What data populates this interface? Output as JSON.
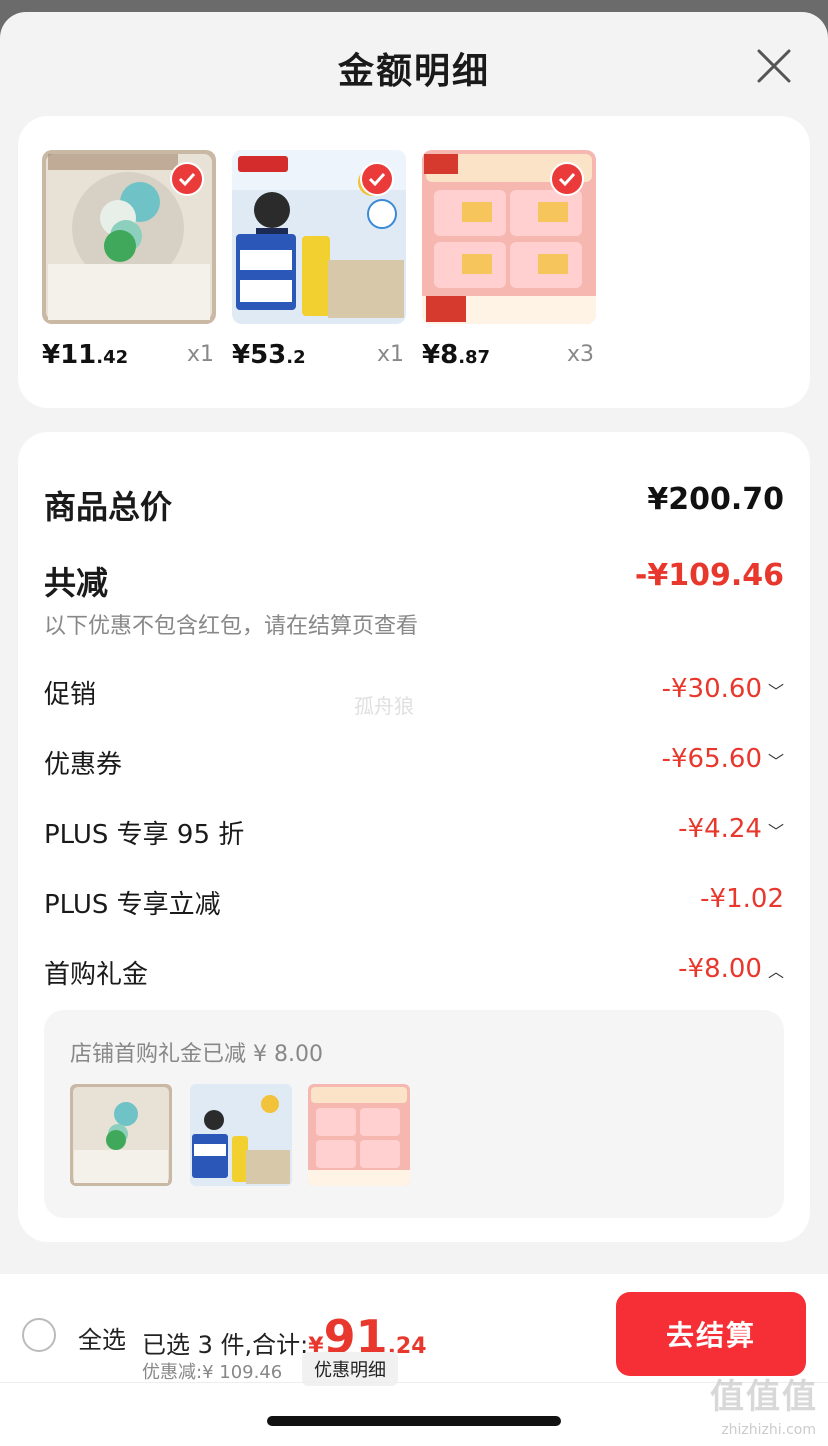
{
  "header": {
    "title": "金额明细"
  },
  "products": [
    {
      "price_main": "¥11",
      "price_dec": ".42",
      "qty": "x1"
    },
    {
      "price_main": "¥53",
      "price_dec": ".2",
      "qty": "x1"
    },
    {
      "price_main": "¥8",
      "price_dec": ".87",
      "qty": "x3"
    }
  ],
  "detail": {
    "total_label": "商品总价",
    "total_value": "¥200.70",
    "reduce_label": "共减",
    "reduce_value": "-¥109.46",
    "note": "以下优惠不包含红包，请在结算页查看",
    "items": [
      {
        "label": "促销",
        "value": "-¥30.60"
      },
      {
        "label": "优惠券",
        "value": "-¥65.60"
      },
      {
        "label": "PLUS 专享 95 折",
        "value": "-¥4.24"
      },
      {
        "label": "PLUS 专享立减",
        "value": "-¥1.02"
      },
      {
        "label": "首购礼金",
        "value": "-¥8.00"
      }
    ],
    "gift_text": "店铺首购礼金已减 ¥ 8.00"
  },
  "watermark": "孤舟狼",
  "bottom_bar": {
    "select_all": "全选",
    "selected_text": "已选 3 件,合计:",
    "total_yen": "¥",
    "total_int": "91",
    "total_dec": ".24",
    "saved_text": "优惠减:¥ 109.46",
    "discount_detail": "优惠明细",
    "checkout": "去结算"
  },
  "site_watermark": {
    "logo": "值值值",
    "url": "zhizhizhi.com"
  },
  "colors": {
    "accent": "#e8372c",
    "checkout_bg": "#f52f35"
  }
}
